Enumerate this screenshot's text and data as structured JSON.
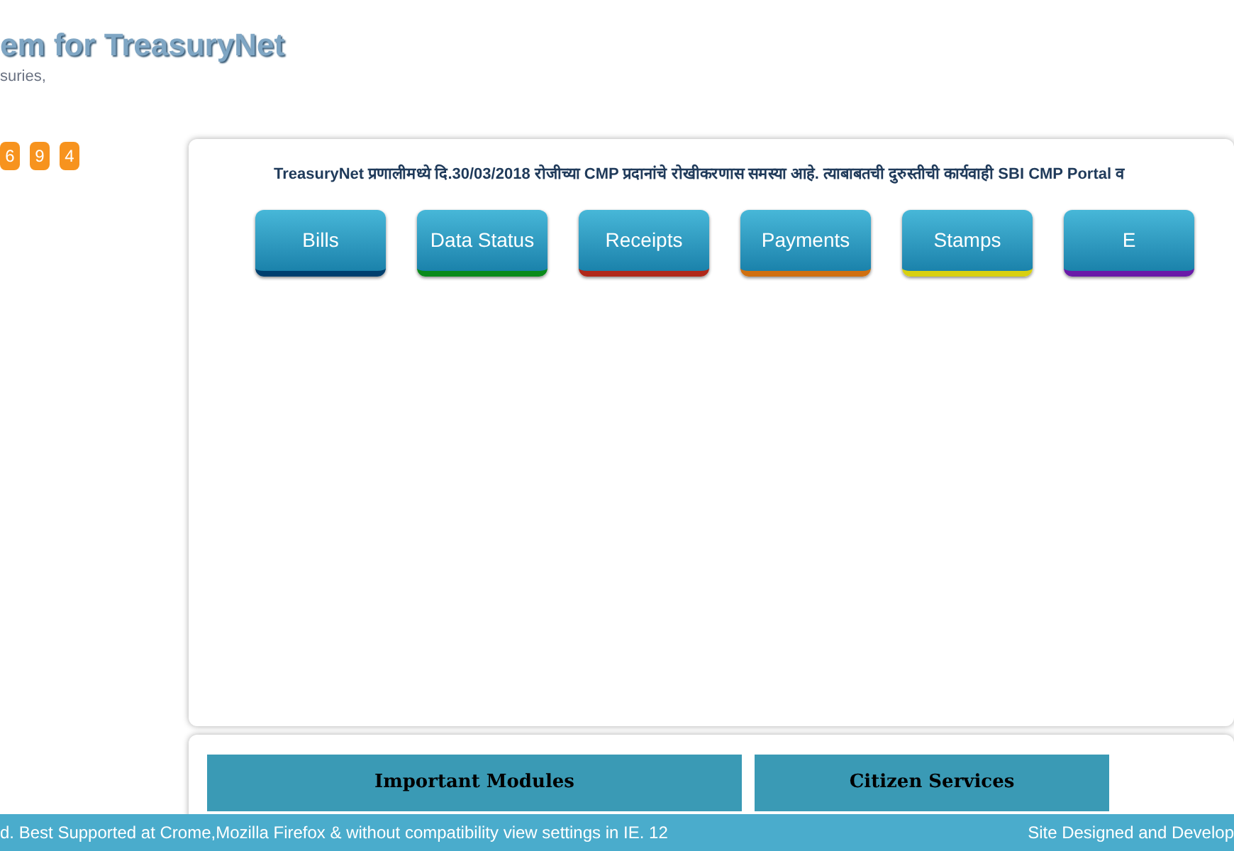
{
  "header": {
    "title": "em for TreasuryNet",
    "subtitle": "suries,"
  },
  "counter": [
    "6",
    "9",
    "4"
  ],
  "notice": "TreasuryNet प्रणालीमध्ये दि.30/03/2018 रोजीच्या CMP प्रदानांचे रोखीकरणास समस्या आहे. त्याबाबतची दुरुस्तीची कार्यवाही SBI CMP Portal व",
  "modules": [
    {
      "label": "Bills",
      "color": "#003f6e"
    },
    {
      "label": "Data Status",
      "color": "#0a8a1a"
    },
    {
      "label": "Receipts",
      "color": "#b0281a"
    },
    {
      "label": "Payments",
      "color": "#d07010"
    },
    {
      "label": "Stamps",
      "color": "#d8d010"
    },
    {
      "label": "E",
      "color": "#6a1aa8"
    }
  ],
  "sections": [
    "Important Modules",
    "Citizen Services"
  ],
  "footer": {
    "left": "d. Best Supported at Crome,Mozilla Firefox & without compatibility view settings in IE. 12",
    "right": "Site Designed and Develop"
  }
}
